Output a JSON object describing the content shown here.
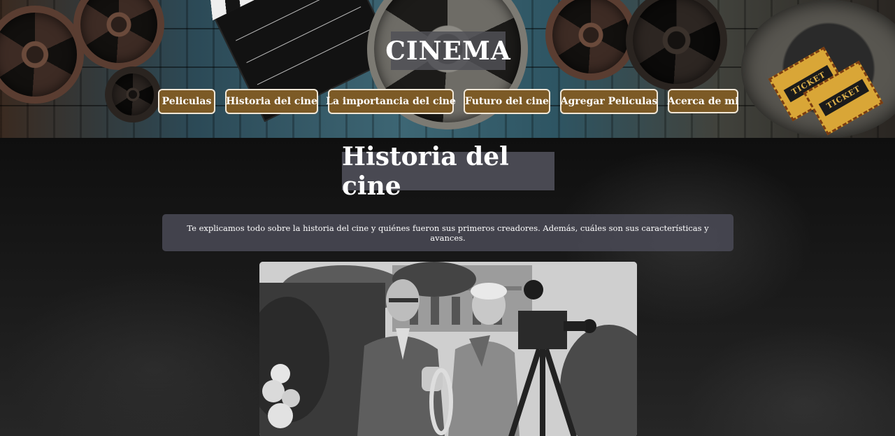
{
  "header": {
    "site_title": "CINEMA",
    "nav": [
      {
        "label": "Peliculas"
      },
      {
        "label": "Historia del cine"
      },
      {
        "label": "La importancia del cine"
      },
      {
        "label": "Futuro del cine"
      },
      {
        "label": "Agregar Peliculas"
      },
      {
        "label": "Acerca de mi"
      }
    ],
    "ticket_text": "TICKET"
  },
  "main": {
    "title": "Historia del cine",
    "intro": "Te explicamos todo sobre la historia del cine y quiénes fueron sus primeros creadores. Además, cuáles son sus características y avances."
  },
  "icons": [
    "film-reel-icon",
    "clapperboard-icon",
    "ticket-icon",
    "movie-camera-icon"
  ]
}
